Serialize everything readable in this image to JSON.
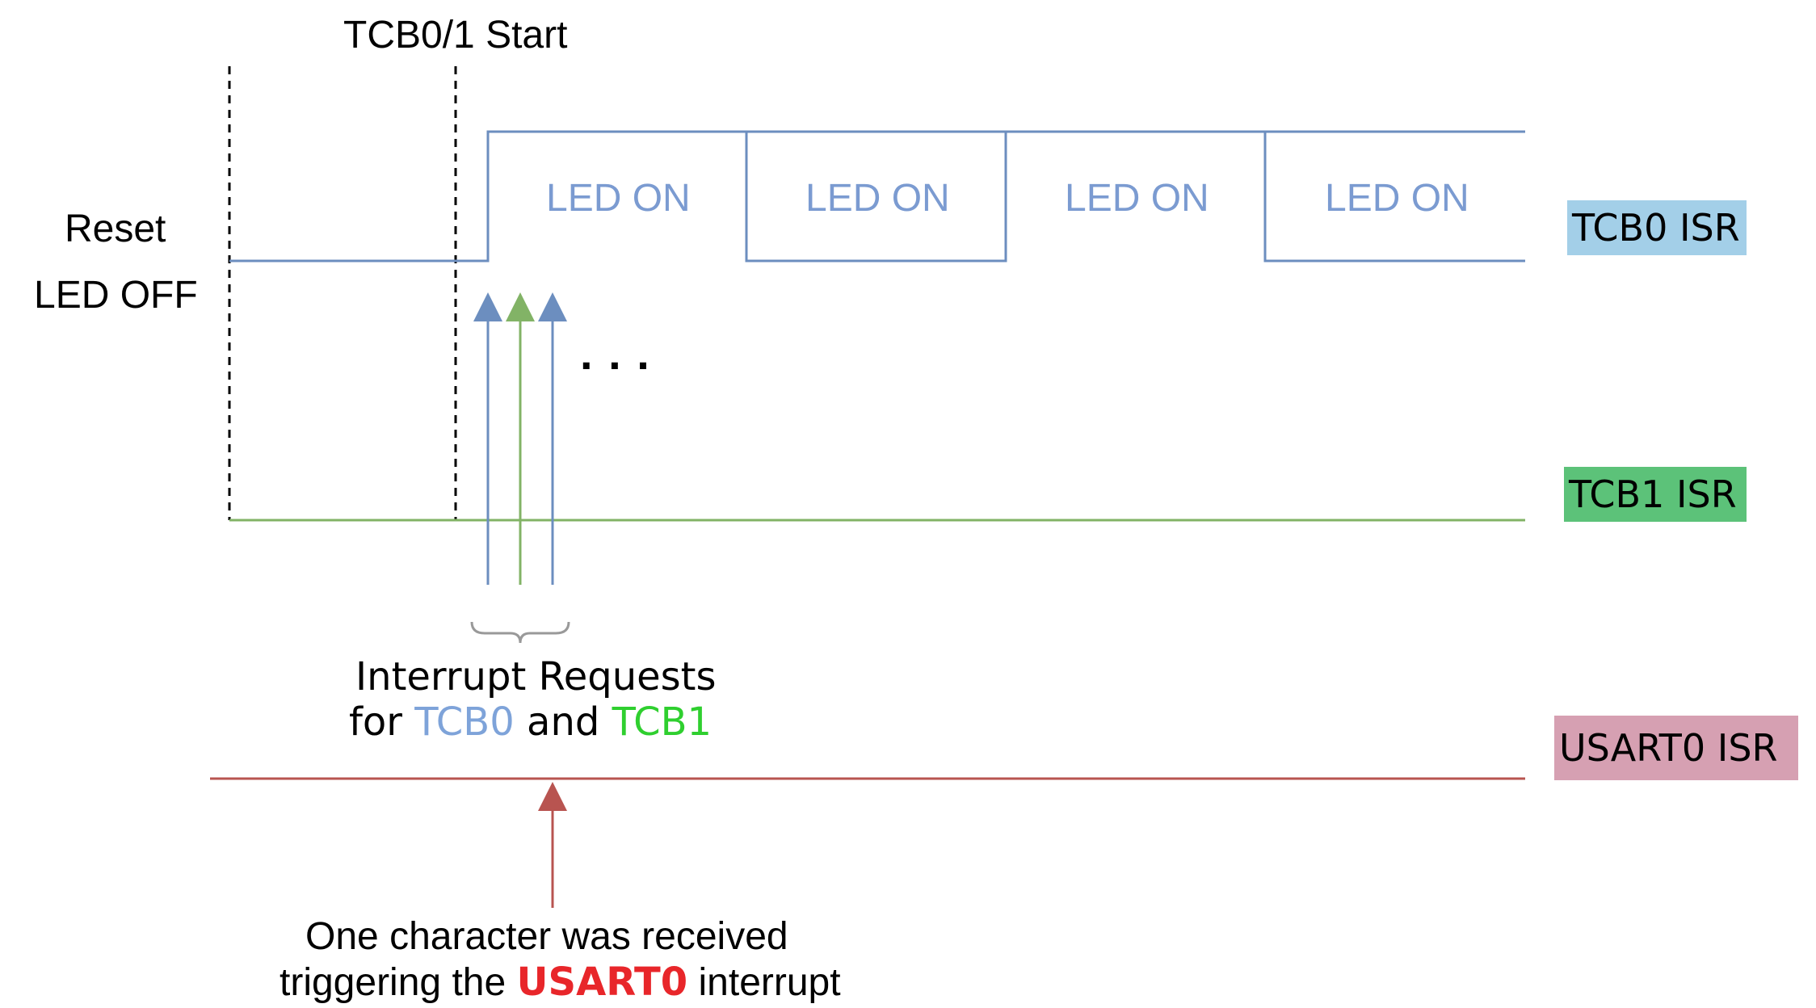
{
  "labels": {
    "start": "TCB0/1 Start",
    "reset": "Reset",
    "led_off": "LED OFF",
    "led_on": [
      "LED ON",
      "LED ON",
      "LED ON",
      "LED ON"
    ],
    "ellipsis": ". . .",
    "interrupt_line1": "Interrupt Requests",
    "interrupt_line2_prefix": "for ",
    "interrupt_tcb0": "TCB0",
    "interrupt_and": " and ",
    "interrupt_tcb1": "TCB1",
    "usart_line1": "One character was received",
    "usart_line2_prefix": "triggering the ",
    "usart_name": "USART0",
    "usart_line2_suffix": " interrupt"
  },
  "tracks": {
    "tcb0": {
      "label": "TCB0 ISR",
      "color": "#a3cfe8",
      "line_color": "#6c8ebf"
    },
    "tcb1": {
      "label": "TCB1 ISR",
      "color": "#5cc279",
      "line_color": "#82b366"
    },
    "usart0": {
      "label": "USART0 ISR",
      "color": "#d6a0b2",
      "line_color": "#b85450"
    }
  }
}
